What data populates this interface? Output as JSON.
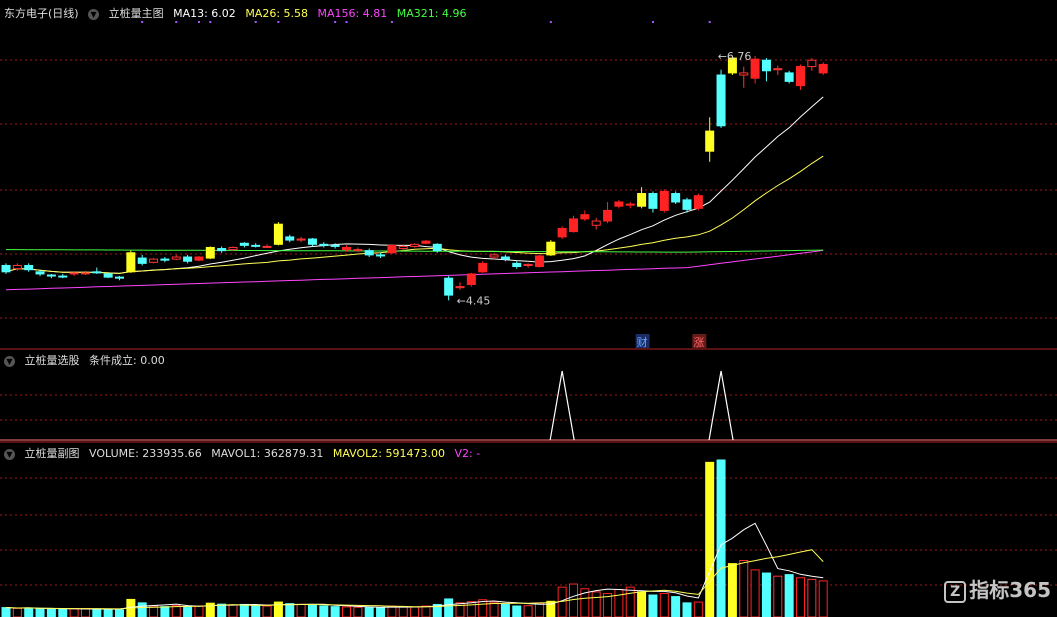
{
  "panel1": {
    "title": "东方电子(日线)",
    "indicator": "立桩量主图",
    "ma": [
      {
        "label": "MA13: 6.02",
        "color": "#ffffff"
      },
      {
        "label": "MA26: 5.58",
        "color": "#ffff55"
      },
      {
        "label": "MA156: 4.81",
        "color": "#ff44ff"
      },
      {
        "label": "MA321: 4.96",
        "color": "#44ff44"
      }
    ]
  },
  "panel2": {
    "indicator": "立桩量选股",
    "condition": "条件成立: 0.00"
  },
  "panel3": {
    "indicator": "立桩量副图",
    "items": [
      {
        "label": "VOLUME: 233935.66",
        "color": "#dddddd"
      },
      {
        "label": "MAVOL1: 362879.31",
        "color": "#dddddd"
      },
      {
        "label": "MAVOL2: 591473.00",
        "color": "#ffff55"
      },
      {
        "label": "V2: -",
        "color": "#ff44ff"
      }
    ]
  },
  "watermark": "指标365",
  "watermark_z": "Z",
  "chart_data": [
    {
      "type": "candlestick",
      "name": "price",
      "annotations": [
        {
          "text": "6.76",
          "index": 62,
          "value": 6.76
        },
        {
          "text": "4.45",
          "index": 39,
          "value": 4.45
        },
        {
          "text": "财",
          "index": 56
        },
        {
          "text": "涨",
          "index": 61
        }
      ],
      "ylim": [
        4.0,
        7.1
      ],
      "ma_lines": [
        {
          "name": "MA13",
          "color": "#ffffff"
        },
        {
          "name": "MA26",
          "color": "#ffff55"
        },
        {
          "name": "MA156",
          "color": "#ff44ff"
        },
        {
          "name": "MA321",
          "color": "#44ff44"
        }
      ],
      "candles": [
        {
          "o": 4.78,
          "c": 4.72,
          "h": 4.8,
          "l": 4.7,
          "k": "down"
        },
        {
          "o": 4.75,
          "c": 4.78,
          "h": 4.8,
          "l": 4.73,
          "k": "up"
        },
        {
          "o": 4.78,
          "c": 4.74,
          "h": 4.8,
          "l": 4.72,
          "k": "down"
        },
        {
          "o": 4.72,
          "c": 4.7,
          "h": 4.74,
          "l": 4.68,
          "k": "down"
        },
        {
          "o": 4.69,
          "c": 4.68,
          "h": 4.7,
          "l": 4.66,
          "k": "down"
        },
        {
          "o": 4.68,
          "c": 4.68,
          "h": 4.7,
          "l": 4.66,
          "k": "down"
        },
        {
          "o": 4.7,
          "c": 4.71,
          "h": 4.72,
          "l": 4.68,
          "k": "up"
        },
        {
          "o": 4.71,
          "c": 4.71,
          "h": 4.73,
          "l": 4.69,
          "k": "up"
        },
        {
          "o": 4.72,
          "c": 4.71,
          "h": 4.76,
          "l": 4.7,
          "k": "down"
        },
        {
          "o": 4.7,
          "c": 4.67,
          "h": 4.71,
          "l": 4.66,
          "k": "down"
        },
        {
          "o": 4.67,
          "c": 4.66,
          "h": 4.68,
          "l": 4.64,
          "k": "down"
        },
        {
          "o": 4.72,
          "c": 4.9,
          "h": 4.92,
          "l": 4.71,
          "k": "yellow"
        },
        {
          "o": 4.85,
          "c": 4.8,
          "h": 4.88,
          "l": 4.78,
          "k": "down"
        },
        {
          "o": 4.81,
          "c": 4.84,
          "h": 4.85,
          "l": 4.8,
          "k": "up"
        },
        {
          "o": 4.84,
          "c": 4.83,
          "h": 4.86,
          "l": 4.81,
          "k": "down"
        },
        {
          "o": 4.84,
          "c": 4.86,
          "h": 4.88,
          "l": 4.83,
          "k": "up"
        },
        {
          "o": 4.86,
          "c": 4.82,
          "h": 4.88,
          "l": 4.8,
          "k": "down"
        },
        {
          "o": 4.83,
          "c": 4.86,
          "h": 4.87,
          "l": 4.82,
          "k": "red"
        },
        {
          "o": 4.85,
          "c": 4.95,
          "h": 4.96,
          "l": 4.84,
          "k": "yellow"
        },
        {
          "o": 4.94,
          "c": 4.92,
          "h": 4.96,
          "l": 4.9,
          "k": "down"
        },
        {
          "o": 4.93,
          "c": 4.95,
          "h": 4.96,
          "l": 4.92,
          "k": "up"
        },
        {
          "o": 4.97,
          "c": 4.99,
          "h": 5.0,
          "l": 4.95,
          "k": "down"
        },
        {
          "o": 4.97,
          "c": 4.97,
          "h": 4.99,
          "l": 4.95,
          "k": "down"
        },
        {
          "o": 4.96,
          "c": 4.96,
          "h": 4.98,
          "l": 4.95,
          "k": "up"
        },
        {
          "o": 4.98,
          "c": 5.17,
          "h": 5.19,
          "l": 4.97,
          "k": "yellow"
        },
        {
          "o": 5.05,
          "c": 5.02,
          "h": 5.07,
          "l": 5.0,
          "k": "down"
        },
        {
          "o": 5.03,
          "c": 5.02,
          "h": 5.05,
          "l": 5.0,
          "k": "up"
        },
        {
          "o": 5.03,
          "c": 4.98,
          "h": 5.04,
          "l": 4.96,
          "k": "down"
        },
        {
          "o": 4.98,
          "c": 4.97,
          "h": 5.0,
          "l": 4.95,
          "k": "down"
        },
        {
          "o": 4.97,
          "c": 4.96,
          "h": 4.99,
          "l": 4.94,
          "k": "down"
        },
        {
          "o": 4.95,
          "c": 4.93,
          "h": 4.97,
          "l": 4.91,
          "k": "red"
        },
        {
          "o": 4.93,
          "c": 4.93,
          "h": 4.95,
          "l": 4.91,
          "k": "up"
        },
        {
          "o": 4.92,
          "c": 4.88,
          "h": 4.94,
          "l": 4.86,
          "k": "down"
        },
        {
          "o": 4.88,
          "c": 4.87,
          "h": 4.9,
          "l": 4.85,
          "k": "down"
        },
        {
          "o": 4.9,
          "c": 4.97,
          "h": 4.98,
          "l": 4.89,
          "k": "red"
        },
        {
          "o": 4.96,
          "c": 4.94,
          "h": 4.98,
          "l": 4.92,
          "k": "up"
        },
        {
          "o": 4.96,
          "c": 4.98,
          "h": 4.99,
          "l": 4.95,
          "k": "up"
        },
        {
          "o": 4.99,
          "c": 5.01,
          "h": 5.02,
          "l": 4.98,
          "k": "red"
        },
        {
          "o": 4.98,
          "c": 4.92,
          "h": 4.99,
          "l": 4.9,
          "k": "down"
        },
        {
          "o": 4.66,
          "c": 4.5,
          "h": 4.68,
          "l": 4.45,
          "k": "down"
        },
        {
          "o": 4.57,
          "c": 4.58,
          "h": 4.62,
          "l": 4.55,
          "k": "up"
        },
        {
          "o": 4.6,
          "c": 4.7,
          "h": 4.71,
          "l": 4.58,
          "k": "red"
        },
        {
          "o": 4.72,
          "c": 4.8,
          "h": 4.82,
          "l": 4.71,
          "k": "red"
        },
        {
          "o": 4.88,
          "c": 4.86,
          "h": 4.9,
          "l": 4.84,
          "k": "up"
        },
        {
          "o": 4.86,
          "c": 4.84,
          "h": 4.88,
          "l": 4.82,
          "k": "down"
        },
        {
          "o": 4.8,
          "c": 4.77,
          "h": 4.82,
          "l": 4.75,
          "k": "down"
        },
        {
          "o": 4.78,
          "c": 4.79,
          "h": 4.8,
          "l": 4.76,
          "k": "up"
        },
        {
          "o": 4.77,
          "c": 4.87,
          "h": 4.88,
          "l": 4.76,
          "k": "red"
        },
        {
          "o": 4.88,
          "c": 5.0,
          "h": 5.02,
          "l": 4.87,
          "k": "yellow"
        },
        {
          "o": 5.05,
          "c": 5.13,
          "h": 5.15,
          "l": 5.03,
          "k": "red"
        },
        {
          "o": 5.1,
          "c": 5.22,
          "h": 5.25,
          "l": 5.09,
          "k": "red"
        },
        {
          "o": 5.22,
          "c": 5.26,
          "h": 5.3,
          "l": 5.2,
          "k": "red"
        },
        {
          "o": 5.2,
          "c": 5.16,
          "h": 5.23,
          "l": 5.12,
          "k": "up"
        },
        {
          "o": 5.2,
          "c": 5.3,
          "h": 5.38,
          "l": 5.18,
          "k": "red"
        },
        {
          "o": 5.34,
          "c": 5.38,
          "h": 5.4,
          "l": 5.32,
          "k": "red"
        },
        {
          "o": 5.36,
          "c": 5.35,
          "h": 5.38,
          "l": 5.32,
          "k": "red"
        },
        {
          "o": 5.34,
          "c": 5.46,
          "h": 5.52,
          "l": 5.32,
          "k": "yellow"
        },
        {
          "o": 5.46,
          "c": 5.32,
          "h": 5.48,
          "l": 5.28,
          "k": "down"
        },
        {
          "o": 5.3,
          "c": 5.48,
          "h": 5.5,
          "l": 5.28,
          "k": "red"
        },
        {
          "o": 5.46,
          "c": 5.38,
          "h": 5.48,
          "l": 5.36,
          "k": "down"
        },
        {
          "o": 5.4,
          "c": 5.31,
          "h": 5.42,
          "l": 5.28,
          "k": "down"
        },
        {
          "o": 5.32,
          "c": 5.44,
          "h": 5.46,
          "l": 5.3,
          "k": "red"
        },
        {
          "o": 6.05,
          "c": 5.86,
          "h": 6.18,
          "l": 5.76,
          "k": "yellow"
        },
        {
          "o": 6.1,
          "c": 6.58,
          "h": 6.63,
          "l": 6.08,
          "k": "down"
        },
        {
          "o": 6.74,
          "c": 6.6,
          "h": 6.76,
          "l": 6.58,
          "k": "yellow"
        },
        {
          "o": 6.6,
          "c": 6.58,
          "h": 6.66,
          "l": 6.46,
          "k": "up"
        },
        {
          "o": 6.55,
          "c": 6.73,
          "h": 6.76,
          "l": 6.5,
          "k": "red"
        },
        {
          "o": 6.72,
          "c": 6.62,
          "h": 6.74,
          "l": 6.52,
          "k": "down"
        },
        {
          "o": 6.64,
          "c": 6.63,
          "h": 6.67,
          "l": 6.58,
          "k": "up"
        },
        {
          "o": 6.6,
          "c": 6.52,
          "h": 6.62,
          "l": 6.5,
          "k": "down"
        },
        {
          "o": 6.48,
          "c": 6.66,
          "h": 6.68,
          "l": 6.44,
          "k": "red"
        },
        {
          "o": 6.66,
          "c": 6.72,
          "h": 6.74,
          "l": 6.62,
          "k": "up"
        },
        {
          "o": 6.68,
          "c": 6.6,
          "h": 6.7,
          "l": 6.58,
          "k": "red"
        }
      ]
    },
    {
      "type": "line",
      "name": "signal",
      "x": [
        49,
        63
      ],
      "peaks": [
        1,
        1
      ],
      "ylim": [
        0,
        1
      ]
    },
    {
      "type": "bar",
      "name": "volume",
      "ylim": [
        0,
        1000000
      ],
      "values": [
        60000,
        55000,
        58000,
        52000,
        50000,
        48000,
        52000,
        54000,
        50000,
        48000,
        46000,
        112000,
        90000,
        70000,
        66000,
        72000,
        64000,
        70000,
        88000,
        82000,
        76000,
        80000,
        72000,
        70000,
        95000,
        85000,
        80000,
        76000,
        70000,
        66000,
        64000,
        62000,
        60000,
        58000,
        70000,
        66000,
        64000,
        70000,
        80000,
        115000,
        90000,
        98000,
        110000,
        95000,
        80000,
        70000,
        72000,
        88000,
        100000,
        190000,
        210000,
        180000,
        160000,
        150000,
        175000,
        190000,
        160000,
        140000,
        150000,
        130000,
        90000,
        95000,
        985000,
        1000000,
        340000,
        360000,
        300000,
        280000,
        260000,
        270000,
        250000,
        240000,
        230000
      ],
      "kinds": [
        "down",
        "up",
        "down",
        "down",
        "down",
        "down",
        "up",
        "up",
        "down",
        "down",
        "down",
        "yellow",
        "down",
        "up",
        "down",
        "up",
        "down",
        "red",
        "yellow",
        "down",
        "up",
        "down",
        "down",
        "up",
        "yellow",
        "down",
        "up",
        "down",
        "down",
        "down",
        "red",
        "up",
        "down",
        "down",
        "red",
        "up",
        "up",
        "red",
        "down",
        "down",
        "up",
        "red",
        "red",
        "up",
        "down",
        "down",
        "up",
        "red",
        "yellow",
        "red",
        "red",
        "red",
        "up",
        "red",
        "red",
        "red",
        "yellow",
        "down",
        "red",
        "down",
        "down",
        "red",
        "yellow",
        "down",
        "yellow",
        "up",
        "red",
        "down",
        "up",
        "down",
        "red",
        "up",
        "red"
      ]
    }
  ],
  "colors": {
    "up": "#ff3333",
    "down": "#54ffff",
    "red": "#ff2222",
    "yellow": "#ffff22",
    "grid": "#9e1a1a",
    "text": "#dddddd"
  }
}
